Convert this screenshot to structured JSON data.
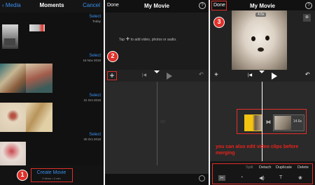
{
  "panel1": {
    "back_label": "Media",
    "title": "Moments",
    "cancel_label": "Cancel",
    "sections": [
      {
        "select_label": "Select",
        "date": "Today"
      },
      {
        "select_label": "Select",
        "date": "16 Nov 2018"
      },
      {
        "select_label": "Select",
        "date": "31 Oct 2018"
      },
      {
        "select_label": "Select",
        "date": "30 Oct 2018"
      }
    ],
    "create_movie_label": "Create Movie",
    "create_movie_sub": "0 items • 0 min",
    "step_badge": "1"
  },
  "panel2": {
    "done_label": "Done",
    "title": "My Movie",
    "help_label": "?",
    "tap_prefix": "Tap",
    "tap_suffix": "to add video, photos or audio.",
    "step_badge": "2"
  },
  "panel3": {
    "done_label": "Done",
    "title": "My Movie",
    "help_label": "?",
    "clip_duration_top": "4.6s",
    "clip_duration": "14.6s",
    "note": "you can also edit video clips before merging",
    "edit_actions": [
      "Split",
      "Detach",
      "Duplicate",
      "Delete"
    ],
    "step_badge": "3"
  },
  "colors": {
    "accent_blue": "#3a8ff0",
    "highlight_red": "#e0302a",
    "note_red": "#e8231c"
  },
  "icons": [
    "plus-icon",
    "skip-back-icon",
    "play-icon",
    "undo-icon",
    "settings-icon",
    "zoom-icon",
    "scissors-icon",
    "speed-icon",
    "volume-icon",
    "text-icon",
    "filters-icon"
  ]
}
